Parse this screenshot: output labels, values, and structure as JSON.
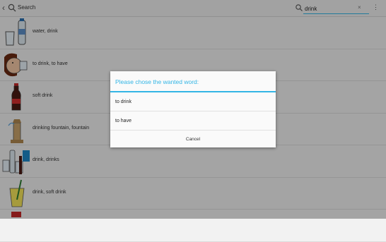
{
  "topbar": {
    "title": "Search",
    "search_value": "drink",
    "clear": "×",
    "overflow": "⋮",
    "back": "‹"
  },
  "list": [
    {
      "label": "water, drink",
      "icon": "water-bottle-icon"
    },
    {
      "label": "to drink, to have",
      "icon": "person-drinking-icon"
    },
    {
      "label": "soft drink",
      "icon": "cola-bottle-icon"
    },
    {
      "label": "drinking fountain, fountain",
      "icon": "drinking-fountain-icon"
    },
    {
      "label": "drink, drinks",
      "icon": "assorted-drinks-icon"
    },
    {
      "label": "drink, soft drink",
      "icon": "glass-with-straw-icon"
    }
  ],
  "dialog": {
    "title": "Please chose the wanted word:",
    "options": [
      "to drink",
      "to have"
    ],
    "cancel": "Cancel"
  },
  "colors": {
    "accent": "#33b5e5"
  }
}
